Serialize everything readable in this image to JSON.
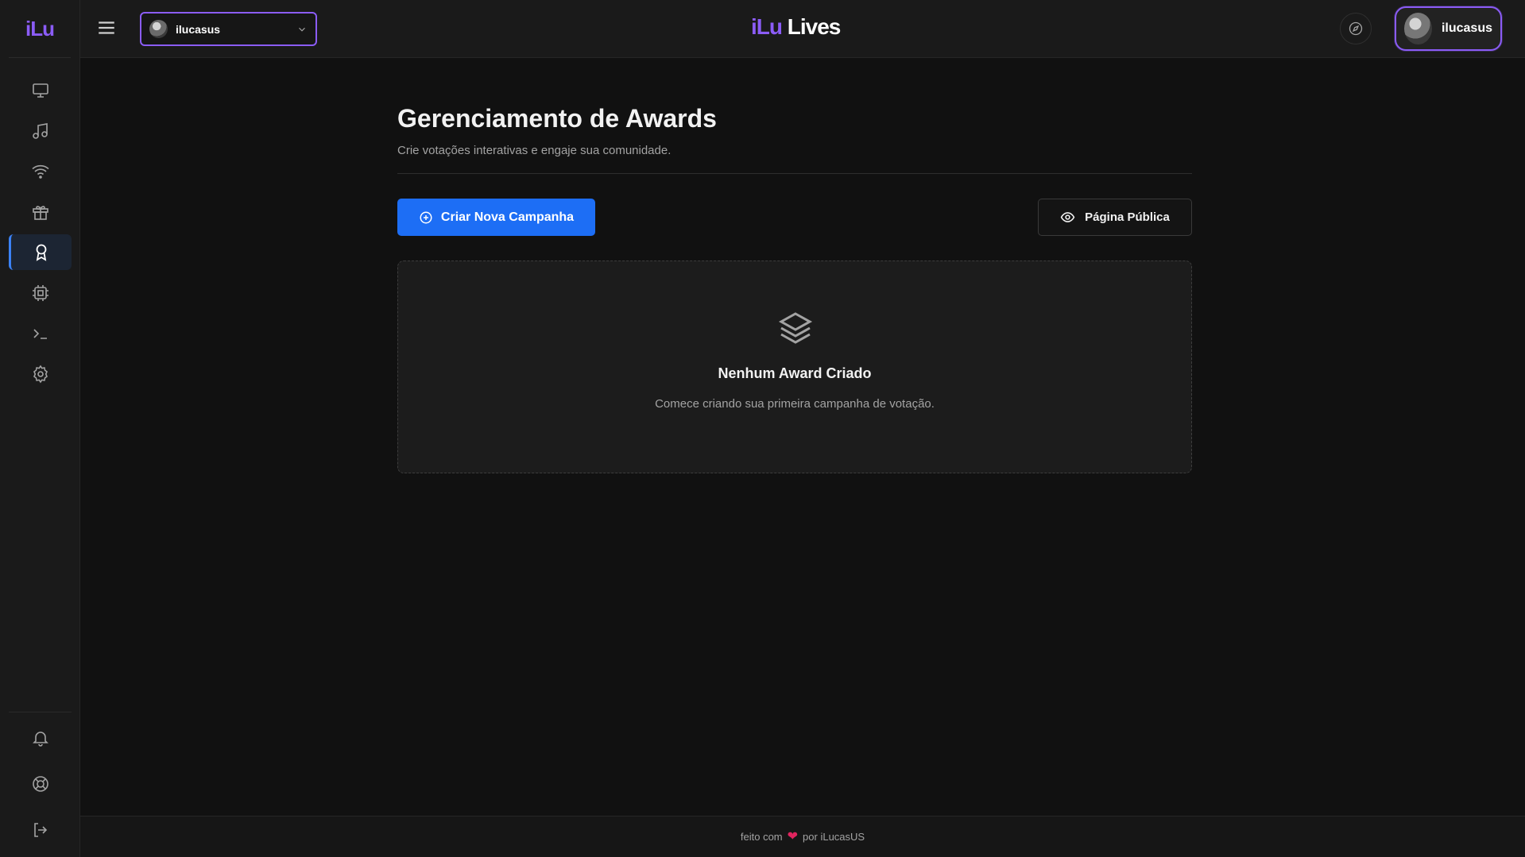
{
  "sidebar": {
    "logo": "iLu",
    "items": [
      {
        "icon": "monitor-icon"
      },
      {
        "icon": "music-icon"
      },
      {
        "icon": "wifi-icon"
      },
      {
        "icon": "gift-icon"
      },
      {
        "icon": "award-icon",
        "active": true
      },
      {
        "icon": "cpu-icon"
      },
      {
        "icon": "terminal-icon"
      },
      {
        "icon": "gear-icon"
      }
    ],
    "bottom_items": [
      {
        "icon": "bell-icon"
      },
      {
        "icon": "lifebuoy-icon"
      },
      {
        "icon": "logout-icon"
      }
    ]
  },
  "header": {
    "account_select": {
      "value": "ilucasus"
    },
    "brand_prefix": "iLu",
    "brand_suffix": "Lives",
    "user_name": "ilucasus"
  },
  "main": {
    "title": "Gerenciamento de Awards",
    "subtitle": "Crie votações interativas e engaje sua comunidade.",
    "create_button": "Criar Nova Campanha",
    "public_page_button": "Página Pública",
    "empty_state": {
      "title": "Nenhum Award Criado",
      "text": "Comece criando sua primeira campanha de votação."
    }
  },
  "footer": {
    "prefix": "feito com",
    "suffix": "por iLucasUS"
  },
  "colors": {
    "accent_purple": "#8b5cf6",
    "primary_blue": "#1d6ef5",
    "heart_red": "#e0245e",
    "background": "#111111"
  }
}
